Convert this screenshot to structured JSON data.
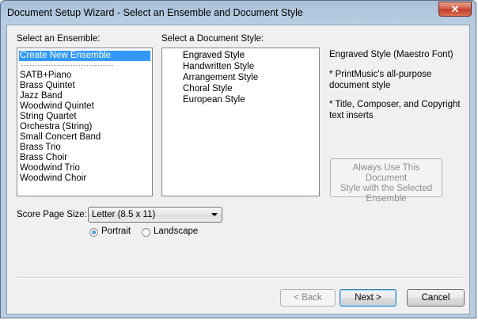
{
  "window": {
    "title": "Document Setup Wizard - Select an Ensemble and Document Style",
    "close_glyph": "✕"
  },
  "ensemble": {
    "label": "Select an Ensemble:",
    "selected": "Create New Ensemble",
    "items": [
      "SATB+Piano",
      "Brass Quintet",
      "Jazz Band",
      "Woodwind Quintet",
      "String Quartet",
      "Orchestra (String)",
      "Small Concert Band",
      "Brass Trio",
      "Brass Choir",
      "Woodwind Trio",
      "Woodwind Choir"
    ]
  },
  "style": {
    "label": "Select a Document Style:",
    "items": [
      "Engraved Style",
      "Handwritten Style",
      "Arrangement Style",
      "Choral Style",
      "European Style"
    ]
  },
  "description": {
    "title": "Engraved Style (Maestro Font)",
    "bullet1": "* PrintMusic's all-purpose document style",
    "bullet2": "* Title, Composer, and Copyright text inserts"
  },
  "always_button": {
    "line1": "Always Use This Document",
    "line2": "Style with the Selected",
    "line3": "Ensemble"
  },
  "page_size": {
    "label": "Score Page Size:",
    "value": "Letter (8.5 x 11)"
  },
  "orientation": {
    "portrait": "Portrait",
    "landscape": "Landscape",
    "selected": "portrait"
  },
  "buttons": {
    "back": "< Back",
    "next": "Next >",
    "cancel": "Cancel"
  }
}
